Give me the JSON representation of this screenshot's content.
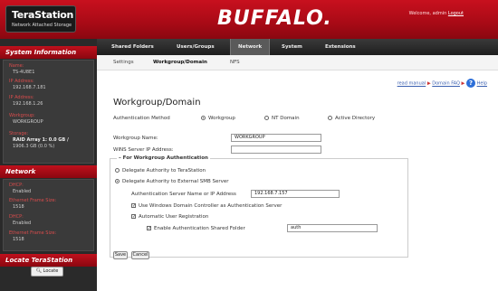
{
  "header": {
    "logo_title": "TeraStation",
    "logo_subtitle": "Network Attached Storage",
    "brand": "BUFFALO.",
    "welcome": "Welcome, admin",
    "logout": "Logout"
  },
  "topnav": {
    "tabs": [
      {
        "label": "Shared Folders"
      },
      {
        "label": "Users/Groups"
      },
      {
        "label": "Network"
      },
      {
        "label": "System"
      },
      {
        "label": "Extensions"
      }
    ],
    "active": "Network"
  },
  "sidebar": {
    "system_info_title": "System Information",
    "name_label": "Name:",
    "name_value": "TS-4U8E1",
    "ip1_label": "IP Address:",
    "ip1_value": "192.168.7.181",
    "ip2_label": "IP Address:",
    "ip2_value": "192.168.1.26",
    "workgroup_label": "Workgroup:",
    "workgroup_value": "WORKGROUP",
    "storage_label": "Storage:",
    "storage_value1": "RAID Array 1: 0.0 GB /",
    "storage_value2": "1906.3 GB (0.0 %)",
    "network_title": "Network",
    "dhcp1_label": "DHCP:",
    "dhcp1_value": "Enabled",
    "frame1_label": "Ethernet Frame Size:",
    "frame1_value": "1518",
    "dhcp2_label": "DHCP:",
    "dhcp2_value": "Enabled",
    "frame2_label": "Ethernet Frame Size:",
    "frame2_value": "1518",
    "locate_title": "Locate TeraStation",
    "locate_button": "Locate"
  },
  "subnav": {
    "items": [
      "Settings",
      "Workgroup/Domain",
      "NFS"
    ],
    "active": "Workgroup/Domain"
  },
  "main": {
    "help_manual": "read manual",
    "help_faq": "Domain FAQ",
    "help_label": "Help",
    "title": "Workgroup/Domain",
    "auth_method_label": "Authentication Method",
    "auth_options": [
      "Workgroup",
      "NT Domain",
      "Active Directory"
    ],
    "auth_selected": "Workgroup",
    "workgroup_name_label": "Workgroup Name:",
    "workgroup_name_value": "WORKGROUP",
    "wins_label": "WINS Server IP Address:",
    "wins_value": "",
    "group_title": "For Workgroup Authentication",
    "delegate_ts": "Delegate Authority to TeraStation",
    "delegate_smb": "Delegate Authority to External SMB Server",
    "auth_server_label": "Authentication Server Name or IP Address",
    "auth_server_value": "192.168.7.157",
    "use_domain_controller": "Use Windows Domain Controller as Authentication Server",
    "auto_user_reg": "Automatic User Registration",
    "enable_shared_folder": "Enable Authentication Shared Folder",
    "shared_folder_value": "auth",
    "save_button": "Save",
    "cancel_button": "Cancel"
  }
}
